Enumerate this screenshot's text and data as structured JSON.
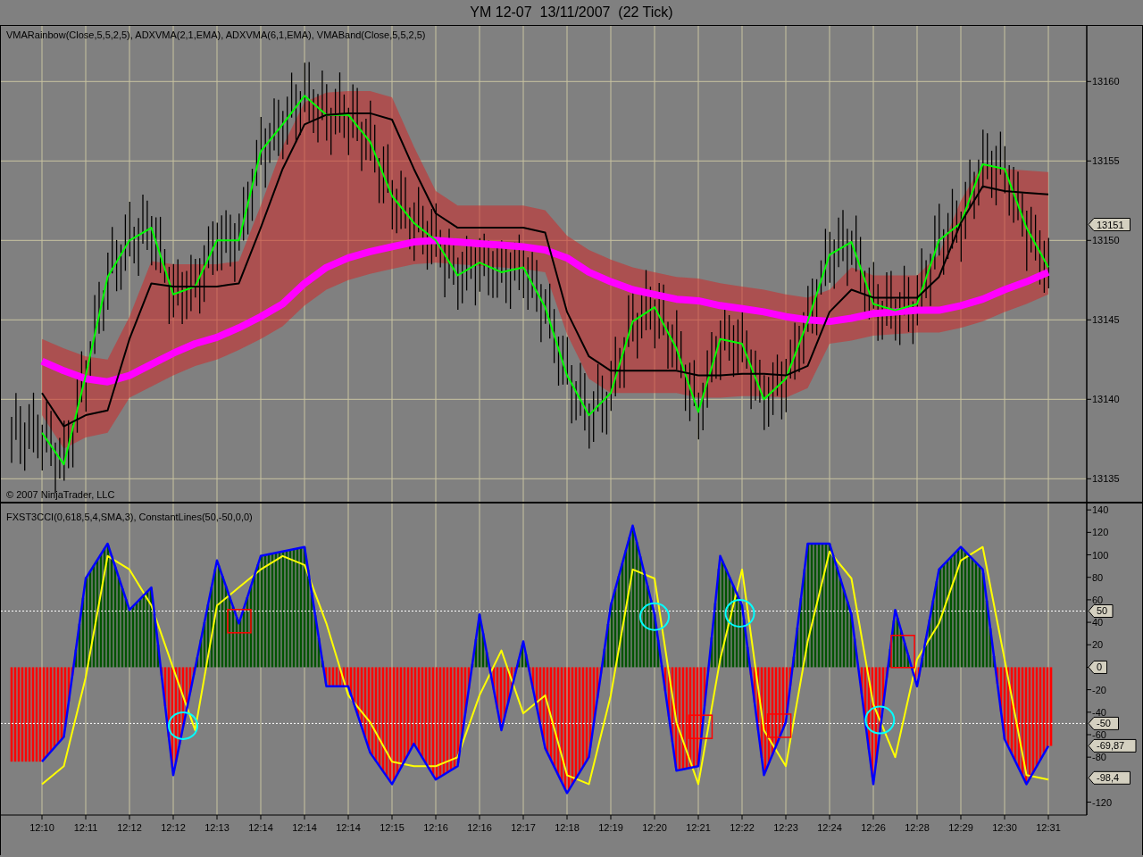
{
  "window": {
    "title": "YM 12-07  13/11/2007  (22 Tick)"
  },
  "price_panel": {
    "legend": "VMARainbow(Close,5,5,2,5), ADXVMA(2,1,EMA), ADXVMA(6,1,EMA), VMABand(Close,5,5,2,5)",
    "copyright": "© 2007 NinjaTrader, LLC",
    "chart_data": {
      "type": "line",
      "grid": true,
      "ylim": [
        13133.5,
        13163.5
      ],
      "yticks": [
        13135,
        13140,
        13145,
        13150,
        13155,
        13160
      ],
      "series": [
        {
          "color": "#ff00ff",
          "values": [
            13142.4,
            13141.8,
            13141.3,
            13141.1,
            13141.5,
            13142.2,
            13142.9,
            13143.5,
            13143.9,
            13144.5,
            13145.2,
            13146,
            13147.3,
            13148.3,
            13148.9,
            13149.3,
            13149.6,
            13149.9,
            13150,
            13149.9,
            13149.8,
            13149.7,
            13149.6,
            13149.4,
            13148.9,
            13148,
            13147.4,
            13146.9,
            13146.6,
            13146.3,
            13146.2,
            13145.9,
            13145.7,
            13145.5,
            13145.2,
            13145,
            13144.9,
            13145.1,
            13145.4,
            13145.5,
            13145.6,
            13145.6,
            13145.9,
            13146.3,
            13146.9,
            13147.4,
            13148
          ]
        },
        {
          "color": "#00ff00",
          "values": [
            13137.9,
            13135.9,
            13141.5,
            13147.7,
            13150,
            13150.8,
            13146.6,
            13147.1,
            13150,
            13150,
            13155.6,
            13157.3,
            13159.1,
            13157.9,
            13157.9,
            13156.2,
            13152.8,
            13151.1,
            13150,
            13147.8,
            13148.6,
            13148,
            13148.3,
            13145.8,
            13141.5,
            13139,
            13140.4,
            13144.9,
            13145.8,
            13143.2,
            13139.2,
            13143.8,
            13143.5,
            13140,
            13141.3,
            13144.9,
            13149.1,
            13149.9,
            13146,
            13145.6,
            13146,
            13150,
            13151.1,
            13154.8,
            13154.5,
            13150.8,
            13148.3
          ]
        },
        {
          "color": "#000000",
          "values": [
            13140.4,
            13138.3,
            13139,
            13139.3,
            13143.8,
            13147.3,
            13147.1,
            13147.1,
            13147.1,
            13147.3,
            13150.8,
            13154.5,
            13157.3,
            13157.9,
            13158,
            13158,
            13157.6,
            13154.5,
            13151.7,
            13150.8,
            13150.8,
            13150.8,
            13150.8,
            13150.5,
            13145.5,
            13142.7,
            13141.8,
            13141.8,
            13141.8,
            13141.8,
            13141.5,
            13141.5,
            13141.6,
            13141.6,
            13141.5,
            13142.1,
            13145.5,
            13146.9,
            13146.4,
            13146.4,
            13146.4,
            13147.7,
            13151.1,
            13153.4,
            13153.1,
            13153,
            13152.9
          ]
        }
      ],
      "annotations": [
        "13151"
      ]
    }
  },
  "cci_panel": {
    "legend": "FXST3CCI(0,618,5,4,SMA,3), ConstantLines(50,-50,0,0)",
    "chart_data": {
      "type": "line",
      "grid": true,
      "ylim": [
        -131.5,
        146.5
      ],
      "yticks": [
        -120,
        -80,
        -60,
        -40,
        -20,
        0,
        20,
        40,
        60,
        80,
        100,
        120,
        140
      ],
      "categories": [
        "12:10",
        null,
        "12:11",
        null,
        "12:12",
        null,
        "12:12",
        null,
        "12:13",
        null,
        "12:14",
        null,
        "12:14",
        null,
        "12:14",
        null,
        "12:15",
        null,
        "12:16",
        null,
        "12:16",
        null,
        "12:17",
        null,
        "12:18",
        null,
        "12:19",
        null,
        "12:20",
        null,
        "12:21",
        null,
        "12:22",
        null,
        "12:23",
        null,
        "12:24",
        null,
        "12:26",
        null,
        "12:28",
        null,
        "12:29",
        null,
        "12:30",
        null,
        "12:31"
      ],
      "series": [
        {
          "color": "#0000ff",
          "values": [
            -84,
            -62,
            79,
            110,
            51,
            71,
            -96,
            -1,
            95,
            39,
            99,
            103,
            107,
            -17,
            -17,
            -76,
            -104,
            -68,
            -100,
            -88,
            47,
            -56,
            23,
            -72,
            -112,
            -80,
            55,
            126,
            47,
            -92,
            -88,
            99,
            55,
            -96,
            -49,
            110,
            110,
            47,
            -104,
            51,
            -17,
            87,
            107,
            87,
            -64,
            -104,
            -70
          ]
        },
        {
          "color": "#ffff00",
          "values": [
            -104,
            -88,
            -9,
            99,
            87,
            55,
            -1,
            -56,
            55,
            71,
            87,
            99,
            91,
            39,
            -25,
            -49,
            -84,
            -88,
            -88,
            -80,
            -25,
            15,
            -41,
            -25,
            -96,
            -104,
            -25,
            87,
            79,
            -49,
            -104,
            7,
            87,
            -56,
            -88,
            23,
            103,
            79,
            -33,
            -80,
            7,
            39,
            95,
            107,
            7,
            -96,
            -100
          ]
        }
      ],
      "ref_lines": [
        {
          "axis": "y",
          "value": 50,
          "label": "50"
        },
        {
          "axis": "y",
          "value": -50,
          "label": "-50"
        }
      ],
      "annotations": [
        "0",
        "-69,87",
        "-98,4"
      ]
    }
  }
}
